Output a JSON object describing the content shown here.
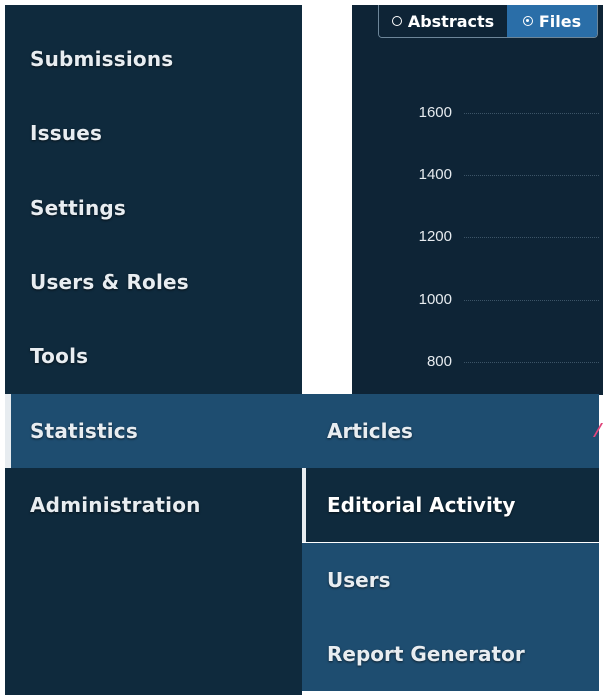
{
  "colors": {
    "sidebar_bg": "#0f2a3d",
    "active_bg": "#1e4d70",
    "content_bg": "#0e2436",
    "toggle_selected_bg": "#2a6ea8",
    "text": "#e8edf1"
  },
  "sidebar": {
    "items": [
      {
        "label": "Submissions",
        "active": false
      },
      {
        "label": "Issues",
        "active": false
      },
      {
        "label": "Settings",
        "active": false
      },
      {
        "label": "Users & Roles",
        "active": false
      },
      {
        "label": "Tools",
        "active": false
      },
      {
        "label": "Statistics",
        "active": true
      },
      {
        "label": "Administration",
        "active": false
      }
    ]
  },
  "submenu": {
    "items": [
      {
        "label": "Articles"
      },
      {
        "label": "Editorial Activity",
        "active": true
      },
      {
        "label": "Users"
      },
      {
        "label": "Report Generator"
      }
    ]
  },
  "chart_toggle": {
    "options": [
      {
        "label": "Abstracts",
        "selected": false
      },
      {
        "label": "Files",
        "selected": true
      }
    ]
  },
  "chart_data": {
    "type": "line",
    "y_ticks": [
      "1600",
      "1400",
      "1200",
      "1000",
      "800"
    ]
  }
}
